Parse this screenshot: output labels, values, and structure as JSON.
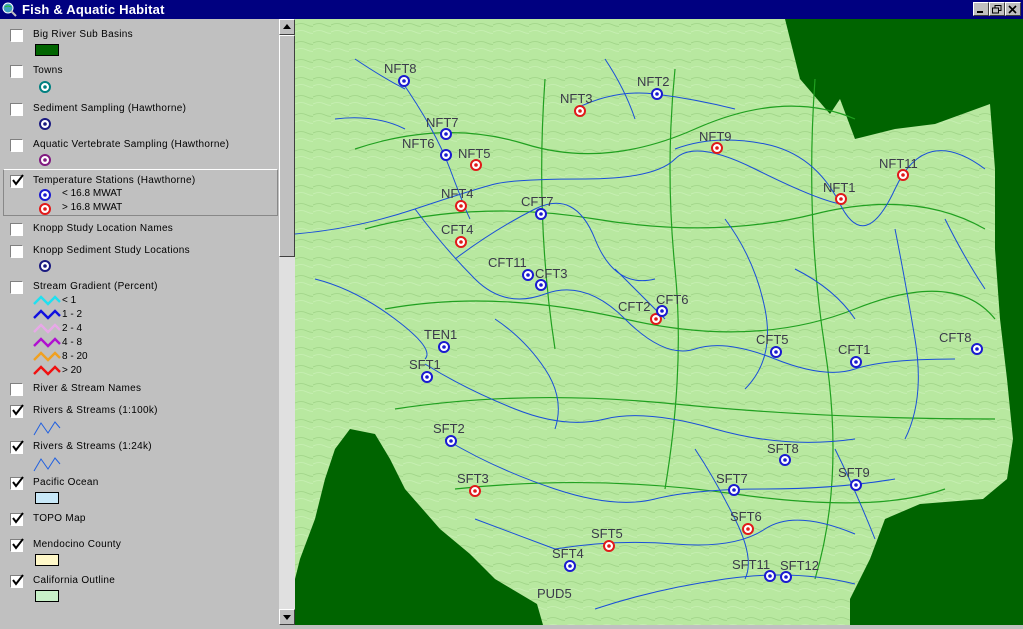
{
  "window": {
    "title": "Fish & Aquatic Habitat"
  },
  "toc": {
    "layers": [
      {
        "name": "Big River Sub Basins",
        "checked": false
      },
      {
        "name": "Towns",
        "checked": false
      },
      {
        "name": "Sediment Sampling (Hawthorne)",
        "checked": false
      },
      {
        "name": "Aquatic Vertebrate Sampling (Hawthorne)",
        "checked": false
      },
      {
        "name": "Temperature Stations (Hawthorne)",
        "checked": true,
        "classes": [
          "< 16.8 MWAT",
          "> 16.8 MWAT"
        ]
      },
      {
        "name": "Knopp Study Location Names",
        "checked": false
      },
      {
        "name": "Knopp Sediment Study Locations",
        "checked": false
      },
      {
        "name": "Stream Gradient (Percent)",
        "checked": false,
        "classes": [
          "< 1",
          "1 - 2",
          "2 - 4",
          "4 - 8",
          "8 - 20",
          "> 20"
        ]
      },
      {
        "name": "River & Stream Names",
        "checked": false
      },
      {
        "name": "Rivers & Streams (1:100k)",
        "checked": true
      },
      {
        "name": "Rivers & Streams (1:24k)",
        "checked": true
      },
      {
        "name": "Pacific Ocean",
        "checked": true
      },
      {
        "name": "TOPO Map",
        "checked": true
      },
      {
        "name": "Mendocino County",
        "checked": true
      },
      {
        "name": "California Outline",
        "checked": true
      }
    ]
  },
  "map": {
    "stations": [
      {
        "id": "NFT8",
        "mwat": "low"
      },
      {
        "id": "NFT2",
        "mwat": "low"
      },
      {
        "id": "NFT3",
        "mwat": "high"
      },
      {
        "id": "NFT7",
        "mwat": "low"
      },
      {
        "id": "NFT6",
        "mwat": "low"
      },
      {
        "id": "NFT5",
        "mwat": "high"
      },
      {
        "id": "NFT9",
        "mwat": "high"
      },
      {
        "id": "NFT11",
        "mwat": "high"
      },
      {
        "id": "NFT1",
        "mwat": "high"
      },
      {
        "id": "NFT4",
        "mwat": "high"
      },
      {
        "id": "CFT7",
        "mwat": "low"
      },
      {
        "id": "CFT4",
        "mwat": "high"
      },
      {
        "id": "CFT11",
        "mwat": "low"
      },
      {
        "id": "CFT3",
        "mwat": "low"
      },
      {
        "id": "CFT2",
        "mwat": "high"
      },
      {
        "id": "CFT6",
        "mwat": "low"
      },
      {
        "id": "TEN1",
        "mwat": "low"
      },
      {
        "id": "CFT5",
        "mwat": "low"
      },
      {
        "id": "CFT1",
        "mwat": "low"
      },
      {
        "id": "CFT8",
        "mwat": "low"
      },
      {
        "id": "SFT1",
        "mwat": "low"
      },
      {
        "id": "SFT2",
        "mwat": "low"
      },
      {
        "id": "SFT8",
        "mwat": "low"
      },
      {
        "id": "SFT3",
        "mwat": "high"
      },
      {
        "id": "SFT7",
        "mwat": "low"
      },
      {
        "id": "SFT9",
        "mwat": "low"
      },
      {
        "id": "SFT6",
        "mwat": "high"
      },
      {
        "id": "SFT5",
        "mwat": "high"
      },
      {
        "id": "SFT4",
        "mwat": "low"
      },
      {
        "id": "SFT11",
        "mwat": "low"
      },
      {
        "id": "SFT12",
        "mwat": "low"
      }
    ],
    "labels": {
      "pud": "PUD5"
    }
  },
  "colors": {
    "title_bar": "#000080",
    "panel": "#c0c0c0",
    "sub_basin": "#006400",
    "terrain": "#b8e8a0",
    "stream": "#1a4fd8",
    "low_mwat": "#1a1ad0",
    "high_mwat": "#e01a1a",
    "gradient": [
      "#20e0f0",
      "#1010e0",
      "#e8a8e8",
      "#b010d0",
      "#f0a020",
      "#f01010"
    ]
  }
}
